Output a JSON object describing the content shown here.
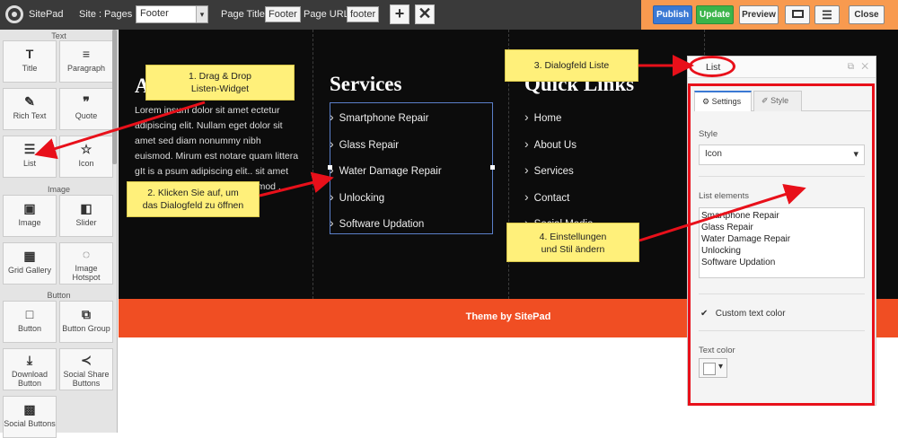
{
  "toolbar": {
    "app_name": "SitePad",
    "site_label": "Site :",
    "pages_label": "Pages :",
    "pages_value": "Footer",
    "page_title_label": "Page Title:",
    "page_title_value": "Footer",
    "page_url_label": "Page URL:",
    "page_url_value": "footer",
    "add_icon": "plus-icon",
    "delete_icon": "x-icon",
    "publish_label": "Publish",
    "update_label": "Update",
    "preview_label": "Preview",
    "desktop_icon": "monitor-icon",
    "menu_icon": "hamburger-icon",
    "close_label": "Close",
    "publish_color": "#3a79d4",
    "update_color": "#3bb44a",
    "accent_color": "#f89a4f"
  },
  "sidebar": {
    "sections": [
      "Text",
      "Image",
      "Button"
    ],
    "widgets": [
      {
        "label": "Title",
        "icon": "title-icon",
        "glyph": "T"
      },
      {
        "label": "Paragraph",
        "icon": "paragraph-icon",
        "glyph": "≡"
      },
      {
        "label": "Rich Text",
        "icon": "edit-icon",
        "glyph": "✎"
      },
      {
        "label": "Quote",
        "icon": "quote-icon",
        "glyph": "❞"
      },
      {
        "label": "List",
        "icon": "list-icon",
        "glyph": "☰"
      },
      {
        "label": "Icon",
        "icon": "star-icon",
        "glyph": "☆"
      },
      {
        "label": "Image",
        "icon": "image-icon",
        "glyph": "▣"
      },
      {
        "label": "Slider",
        "icon": "slider-icon",
        "glyph": "◧"
      },
      {
        "label": "Grid Gallery",
        "icon": "grid-icon",
        "glyph": "▦"
      },
      {
        "label": "Image Hotspot",
        "icon": "hotspot-icon",
        "glyph": "◌"
      },
      {
        "label": "Button",
        "icon": "button-icon",
        "glyph": "□"
      },
      {
        "label": "Button Group",
        "icon": "button-group-icon",
        "glyph": "⧉"
      },
      {
        "label": "Download Button",
        "icon": "download-icon",
        "glyph": "⤓"
      },
      {
        "label": "Social Share Buttons",
        "icon": "share-icon",
        "glyph": "≺"
      },
      {
        "label": "Social Buttons",
        "icon": "social-icon",
        "glyph": "▩"
      }
    ]
  },
  "canvas": {
    "about_heading": "A",
    "about_text": "Lorem ipsum dolor sit amet ectetur adipiscing elit. Nullam eget dolor sit amet sed diam nonummy nibh euismod. Mirum est notare quam littera gIt is a psum adipiscing elit.. sit amet sed diam nonummy nibh euismod .",
    "services_heading": "Services",
    "services": [
      "Smartphone Repair",
      "Glass Repair",
      "Water Damage Repair",
      "Unlocking",
      "Software Updation"
    ],
    "quicklinks_heading": "Quick Links",
    "quicklinks": [
      "Home",
      "About Us",
      "Services",
      "Contact",
      "Social Media"
    ],
    "footer_text": "Theme by SitePad",
    "footer_color": "#f04e23"
  },
  "dialog": {
    "title": "List",
    "restore_icon": "restore-icon",
    "close_icon": "close-icon",
    "tab_settings": "Settings",
    "tab_style": "Style",
    "style_label": "Style",
    "style_value": "Icon",
    "list_elements_label": "List elements",
    "list_elements": "Smartphone Repair\nGlass Repair\nWater Damage Repair\nUnlocking\nSoftware Updation",
    "custom_text_color_label": "Custom text color",
    "custom_text_color_checked": true,
    "text_color_label": "Text color"
  },
  "callouts": {
    "c1": "1. Drag & Drop\nListen-Widget",
    "c2": "2. Klicken Sie auf, um\ndas Dialogfeld zu öffnen",
    "c3": "3. Dialogfeld Liste",
    "c4": "4. Einstellungen\nund Stil ändern",
    "highlight_color": "#e8101a"
  }
}
